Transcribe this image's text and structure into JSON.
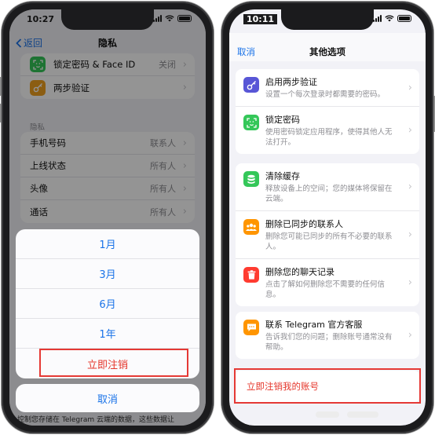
{
  "left_phone": {
    "status": {
      "time": "10:27"
    },
    "nav": {
      "back_label": "返回",
      "title": "隐私"
    },
    "security_rows": [
      {
        "label": "锁定密码 & Face ID",
        "value": "关闭",
        "icon": "face-id-icon",
        "color": "#34c759"
      },
      {
        "label": "两步验证",
        "value": "",
        "icon": "key-icon",
        "color": "#f0a020"
      }
    ],
    "privacy_section_label": "隐私",
    "privacy_rows": [
      {
        "label": "手机号码",
        "value": "联系人"
      },
      {
        "label": "上线状态",
        "value": "所有人"
      },
      {
        "label": "头像",
        "value": "所有人"
      },
      {
        "label": "通话",
        "value": "所有人"
      }
    ],
    "sheet_options": [
      "1月",
      "3月",
      "6月",
      "1年"
    ],
    "sheet_danger": "立即注销",
    "sheet_cancel": "取消",
    "bottom_text": "控制您存储在 Telegram 云端的数据，这些数据让"
  },
  "right_phone": {
    "status": {
      "time": "10:11"
    },
    "nav": {
      "cancel_label": "取消",
      "title": "其他选项"
    },
    "card1": [
      {
        "title": "启用两步验证",
        "desc": "设置一个每次登录时都需要的密码。",
        "icon": "key-icon",
        "color": "#5856d6"
      },
      {
        "title": "锁定密码",
        "desc": "使用密码锁定应用程序，使得其他人无法打开。",
        "icon": "face-id-icon",
        "color": "#34c759"
      }
    ],
    "card2": [
      {
        "title": "清除缓存",
        "desc": "释放设备上的空间；您的媒体将保留在云端。",
        "icon": "database-icon",
        "color": "#34c759"
      },
      {
        "title": "删除已同步的联系人",
        "desc": "删除您可能已同步的所有不必要的联系人。",
        "icon": "contacts-icon",
        "color": "#ff9500"
      },
      {
        "title": "删除您的聊天记录",
        "desc": "点击了解如何删除您不需要的任何信息。",
        "icon": "trash-icon",
        "color": "#ff3b30"
      }
    ],
    "card3": [
      {
        "title": "联系 Telegram 官方客服",
        "desc": "告诉我们您的问题；删除账号通常没有帮助。",
        "icon": "chat-bubble-icon",
        "color": "#ff9500"
      }
    ],
    "delete_label": "立即注销我的账号"
  },
  "colors": {
    "accent": "#1a73e8",
    "danger": "#e5362b",
    "highlight_box": "#e53935"
  }
}
